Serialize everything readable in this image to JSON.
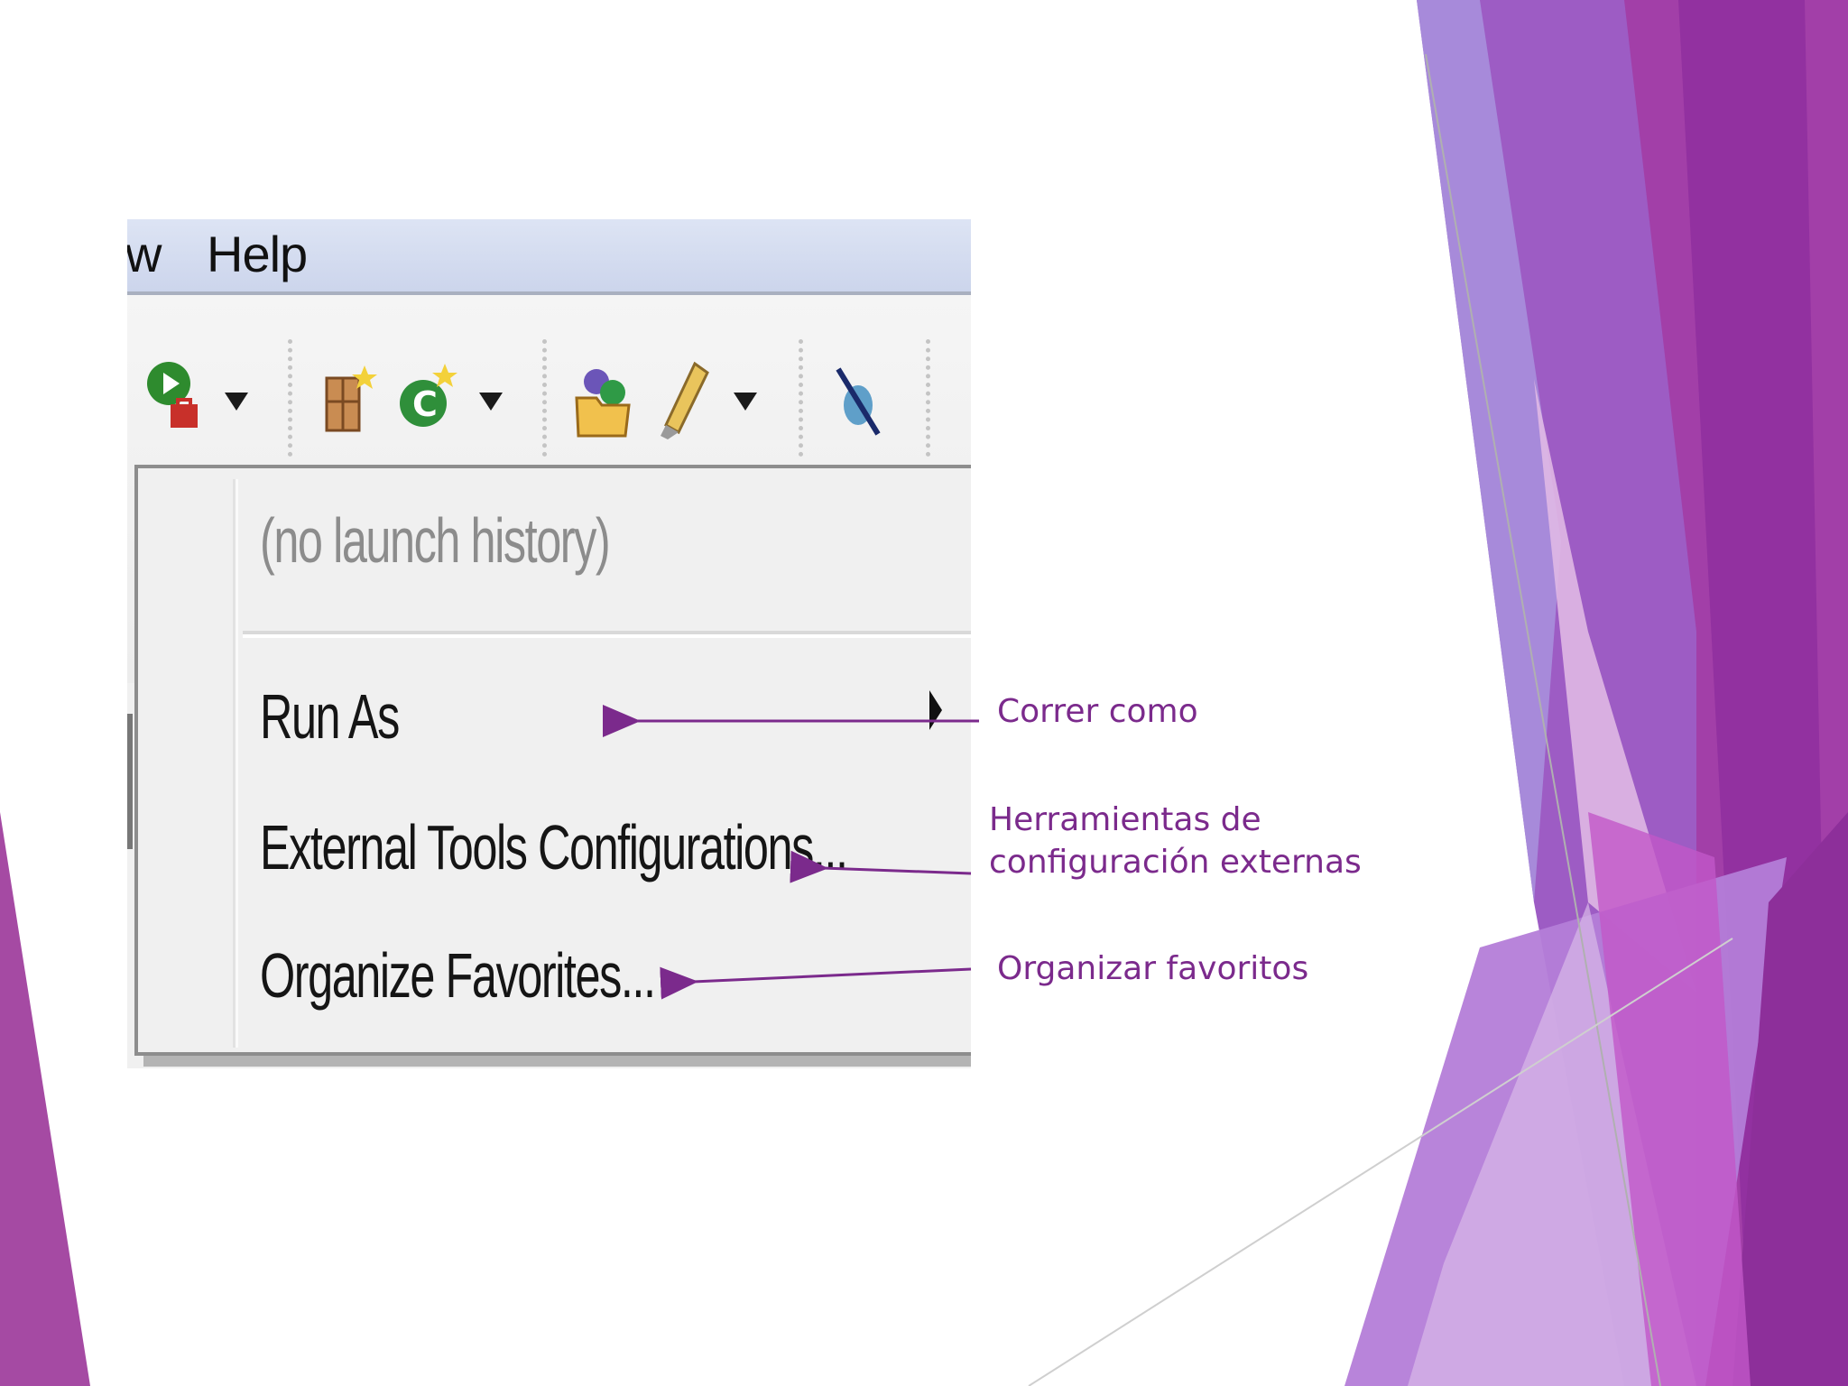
{
  "menubar": {
    "partial_item": "w",
    "help": "Help"
  },
  "toolbar": {
    "icons": [
      "run-external-tools-icon",
      "new-java-package-icon",
      "new-java-class-icon",
      "open-type-icon",
      "search-icon",
      "skip-breakpoints-icon"
    ]
  },
  "run_menu": {
    "no_history": "(no launch history)",
    "run_as": "Run As",
    "external_tools": "External Tools Configurations...",
    "organize_favorites": "Organize Favorites..."
  },
  "annotations": {
    "run_as": "Correr como",
    "external_tools_line1": "Herramientas de",
    "external_tools_line2": "configuración externas",
    "organize_favorites": "Organizar favoritos"
  },
  "colors": {
    "annotation": "#7b2a8c",
    "accent_purple": "#9b3fb0",
    "accent_violet": "#8f5fce"
  }
}
